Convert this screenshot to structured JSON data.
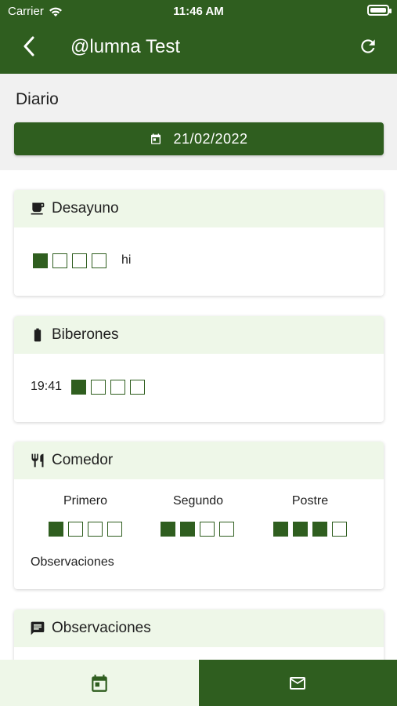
{
  "status": {
    "carrier": "Carrier",
    "time": "11:46 AM"
  },
  "header": {
    "title": "@lumna Test"
  },
  "subheader": {
    "label": "Diario",
    "date": "21/02/2022"
  },
  "desayuno": {
    "title": "Desayuno",
    "rating": 1,
    "max": 4,
    "note": "hi"
  },
  "biberones": {
    "title": "Biberones",
    "time": "19:41",
    "rating": 1,
    "max": 4
  },
  "comedor": {
    "title": "Comedor",
    "courses": [
      {
        "label": "Primero",
        "rating": 1,
        "max": 4
      },
      {
        "label": "Segundo",
        "rating": 2,
        "max": 4
      },
      {
        "label": "Postre",
        "rating": 3,
        "max": 4
      }
    ],
    "observaciones_label": "Observaciones"
  },
  "observaciones": {
    "title": "Observaciones"
  },
  "colors": {
    "accent": "#2f5e1f",
    "accent_light": "#eef7e8"
  },
  "icons": {
    "back": "chevron-left-icon",
    "refresh": "refresh-icon",
    "date": "calendar-icon",
    "desayuno": "coffee-cup-icon",
    "biberones": "battery-bottle-icon",
    "comedor": "fork-knife-icon",
    "observaciones": "chat-bubble-icon",
    "tab_left": "calendar-icon",
    "tab_right": "mail-icon"
  }
}
